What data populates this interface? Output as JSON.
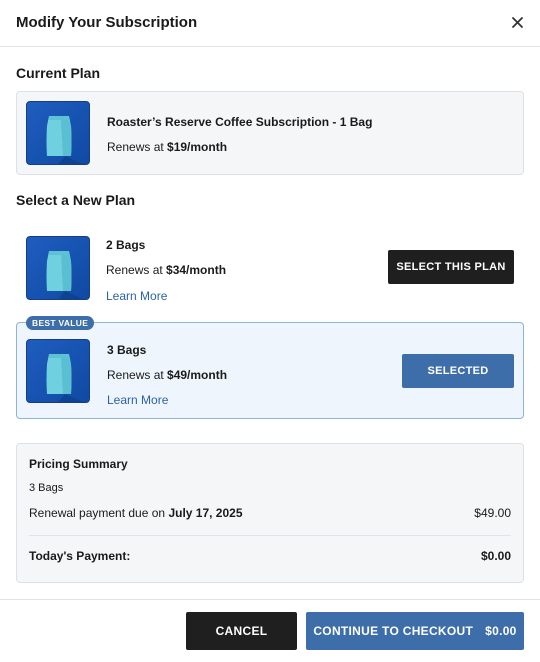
{
  "modal": {
    "title": "Modify Your Subscription"
  },
  "current_plan": {
    "section_title": "Current Plan",
    "name": "Roaster’s Reserve Coffee Subscription - 1 Bag",
    "renew_prefix": "Renews at ",
    "price": "$19/month"
  },
  "new_plan": {
    "section_title": "Select a New Plan",
    "options": [
      {
        "name": "2 Bags",
        "renew_prefix": "Renews at ",
        "price": "$34/month",
        "learn_more": "Learn More",
        "button_label": "SELECT THIS PLAN"
      },
      {
        "badge": "BEST VALUE",
        "name": "3 Bags",
        "renew_prefix": "Renews at ",
        "price": "$49/month",
        "learn_more": "Learn More",
        "button_label": "SELECTED"
      }
    ]
  },
  "summary": {
    "title": "Pricing Summary",
    "plan": "3 Bags",
    "renewal_prefix": "Renewal payment due on ",
    "renewal_date": "July 17, 2025",
    "renewal_amount": "$49.00",
    "today_label": "Today's Payment:",
    "today_amount": "$0.00"
  },
  "footer": {
    "cancel_label": "CANCEL",
    "checkout_label": "CONTINUE TO CHECKOUT",
    "checkout_amount": "$0.00"
  },
  "icons": {
    "close": "close-icon",
    "product": "coffee-bag-icon"
  },
  "colors": {
    "accent": "#3d6eaa",
    "dark_button": "#1f1f1f",
    "selected_bg": "#eef5fd",
    "thumb_bg": "#1f5dbf",
    "bag": "#6fd0e0"
  }
}
